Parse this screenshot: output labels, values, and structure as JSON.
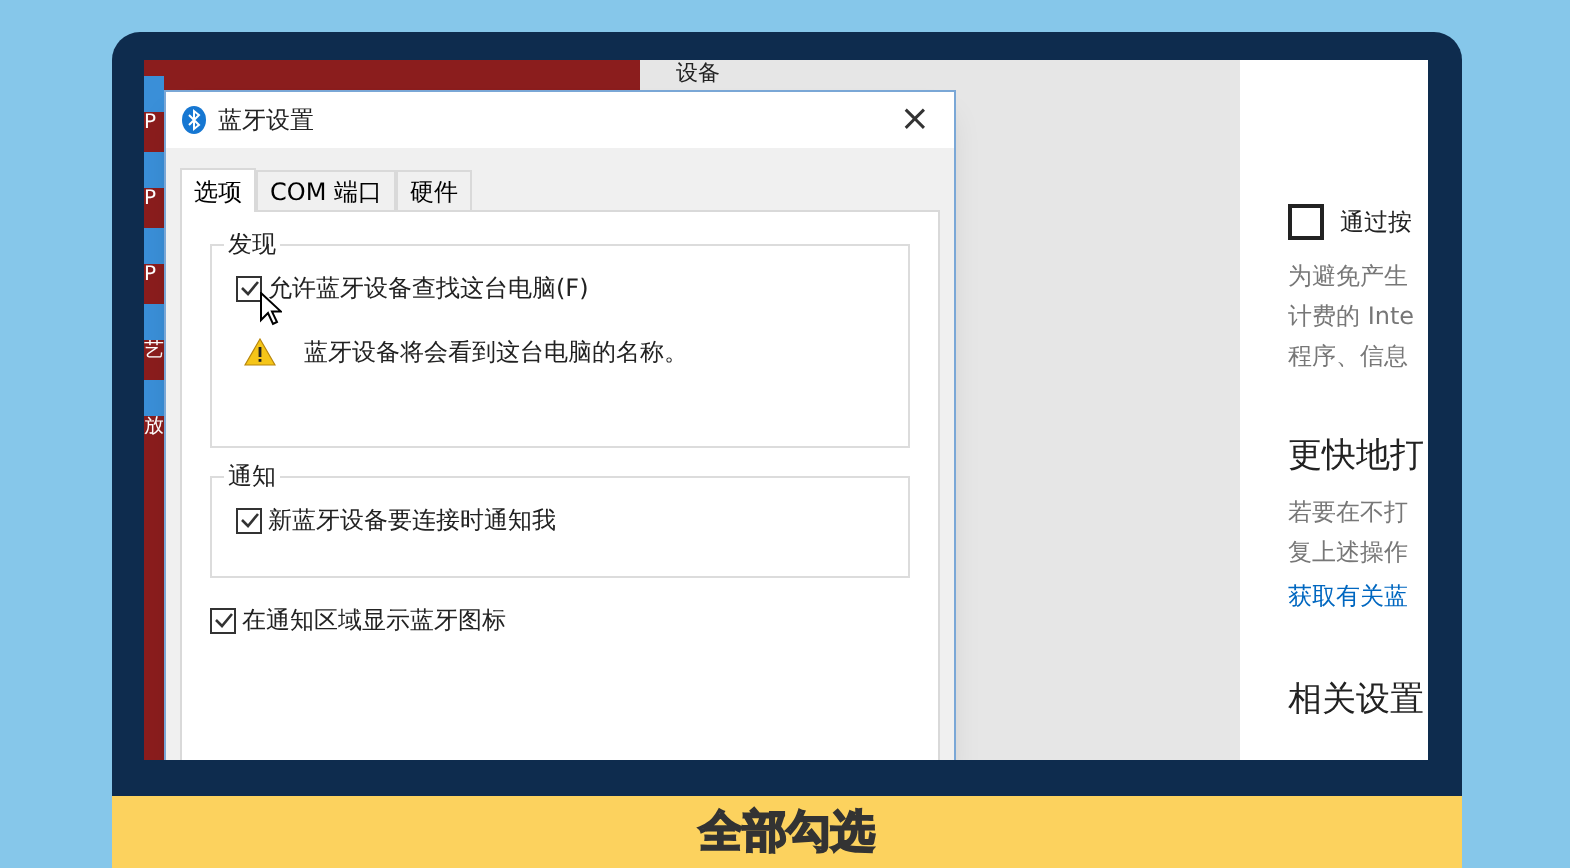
{
  "desktop": {
    "icon_labels": [
      "P",
      "P",
      "P",
      "艺",
      "放"
    ]
  },
  "settings": {
    "heading": "设备",
    "right_panel": [
      {
        "kind": "checkbox",
        "label": "通过按",
        "checked": false
      },
      {
        "kind": "description",
        "text": "为避免产生"
      },
      {
        "kind": "description",
        "text": "计费的 Inte"
      },
      {
        "kind": "description",
        "text": "程序、信息"
      },
      {
        "kind": "heading",
        "text": "更快地打"
      },
      {
        "kind": "description",
        "text": "若要在不打"
      },
      {
        "kind": "description",
        "text": "复上述操作"
      },
      {
        "kind": "link",
        "text": "获取有关蓝"
      },
      {
        "kind": "heading",
        "text": "相关设置"
      }
    ]
  },
  "dialog": {
    "title": "蓝牙设置",
    "close": "×",
    "tabs": [
      {
        "label": "选项",
        "selected": true
      },
      {
        "label": "COM 端口",
        "selected": false
      },
      {
        "label": "硬件",
        "selected": false
      }
    ],
    "groups": [
      {
        "title": "发现",
        "checkbox": {
          "label": "允许蓝牙设备查找这台电脑(F)",
          "checked": true
        },
        "warning": "蓝牙设备将会看到这台电脑的名称。"
      },
      {
        "title": "通知",
        "checkbox": {
          "label": "新蓝牙设备要连接时通知我",
          "checked": true
        }
      }
    ],
    "checkbox": {
      "label": "在通知区域显示蓝牙图标",
      "checked": true
    }
  },
  "caption": "全部勾选"
}
